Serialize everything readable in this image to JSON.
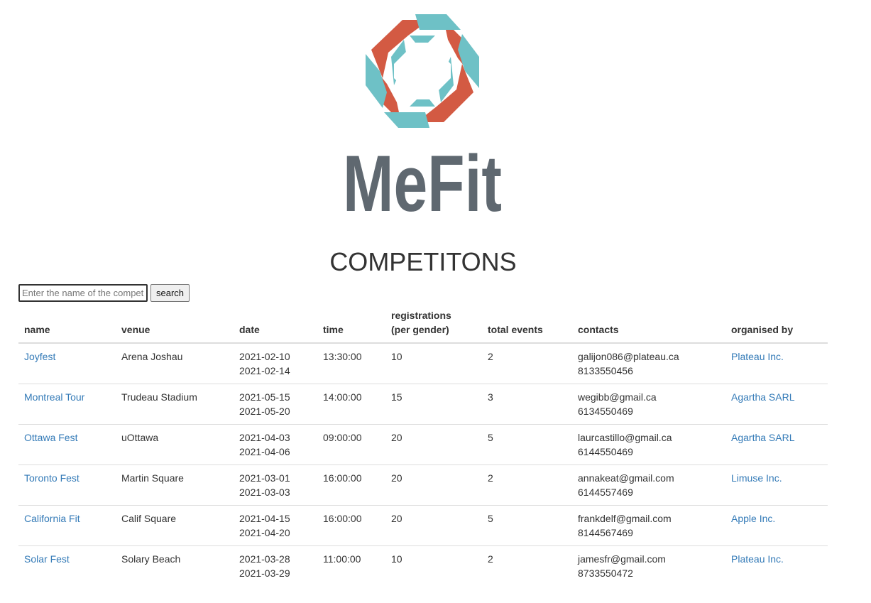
{
  "header": {
    "logo_text": "MeFit",
    "title": "COMPETITONS"
  },
  "search": {
    "placeholder": "Enter the name of the competition",
    "button_label": "search"
  },
  "table": {
    "columns": {
      "name": "name",
      "venue": "venue",
      "date": "date",
      "time": "time",
      "registrations_line1": "registrations",
      "registrations_line2": "(per gender)",
      "total_events": "total events",
      "contacts": "contacts",
      "organised_by": "organised by"
    },
    "rows": [
      {
        "name": "Joyfest",
        "venue": "Arena Joshau",
        "date_start": "2021-02-10",
        "date_end": "2021-02-14",
        "time": "13:30:00",
        "registrations": "10",
        "total_events": "2",
        "email": "galijon086@plateau.ca",
        "phone": "8133550456",
        "organiser": "Plateau Inc."
      },
      {
        "name": "Montreal Tour",
        "venue": "Trudeau Stadium",
        "date_start": "2021-05-15",
        "date_end": "2021-05-20",
        "time": "14:00:00",
        "registrations": "15",
        "total_events": "3",
        "email": "wegibb@gmail.ca",
        "phone": "6134550469",
        "organiser": "Agartha SARL"
      },
      {
        "name": "Ottawa Fest",
        "venue": "uOttawa",
        "date_start": "2021-04-03",
        "date_end": "2021-04-06",
        "time": "09:00:00",
        "registrations": "20",
        "total_events": "5",
        "email": "laurcastillo@gmail.ca",
        "phone": "6144550469",
        "organiser": "Agartha SARL"
      },
      {
        "name": "Toronto Fest",
        "venue": "Martin Square",
        "date_start": "2021-03-01",
        "date_end": "2021-03-03",
        "time": "16:00:00",
        "registrations": "20",
        "total_events": "2",
        "email": "annakeat@gmail.com",
        "phone": "6144557469",
        "organiser": "Limuse Inc."
      },
      {
        "name": "California Fit",
        "venue": "Calif Square",
        "date_start": "2021-04-15",
        "date_end": "2021-04-20",
        "time": "16:00:00",
        "registrations": "20",
        "total_events": "5",
        "email": "frankdelf@gmail.com",
        "phone": "8144567469",
        "organiser": "Apple Inc."
      },
      {
        "name": "Solar Fest",
        "venue": "Solary Beach",
        "date_start": "2021-03-28",
        "date_end": "2021-03-29",
        "time": "11:00:00",
        "registrations": "10",
        "total_events": "2",
        "email": "jamesfr@gmail.com",
        "phone": "8733550472",
        "organiser": "Plateau Inc."
      }
    ]
  }
}
